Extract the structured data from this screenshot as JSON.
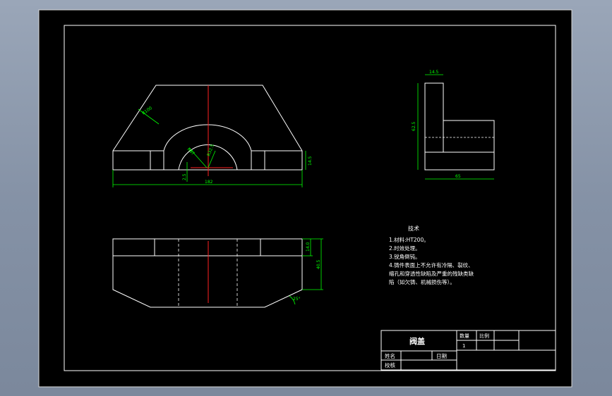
{
  "colors": {
    "background": "#8d99ab",
    "paper": "#000000",
    "line": "#ffffff",
    "centerline": "#ff2020",
    "dimension": "#00ff00"
  },
  "front_view": {
    "dim_radius_outer": "R100",
    "dim_radius_mid": "R67",
    "dim_radius_inner": "R32.5",
    "dim_width": "182",
    "dim_height": "14.5",
    "dim_offset": "2.5"
  },
  "side_view": {
    "dim_top": "14.5",
    "dim_height": "62.5",
    "dim_base": "65"
  },
  "bottom_view": {
    "dim_upper": "14.0",
    "dim_total": "40.5",
    "dim_angle": "25°"
  },
  "notes": {
    "heading": "技术",
    "lines": [
      "1.材料:HT200。",
      "2.时效处理。",
      "3.锐角倒钝。",
      "4.铸件表面上不允许有冷隔、裂纹、",
      "缩孔和穿透性缺陷及严重的残缺类缺",
      "陷（如欠铸、机械损伤等）。"
    ]
  },
  "title_block": {
    "part_name": "阀盖",
    "qty_label": "数量",
    "qty_value": "1",
    "scale_label": "比例",
    "name_label": "姓名",
    "date_label": "日期",
    "check_label": "校核"
  }
}
